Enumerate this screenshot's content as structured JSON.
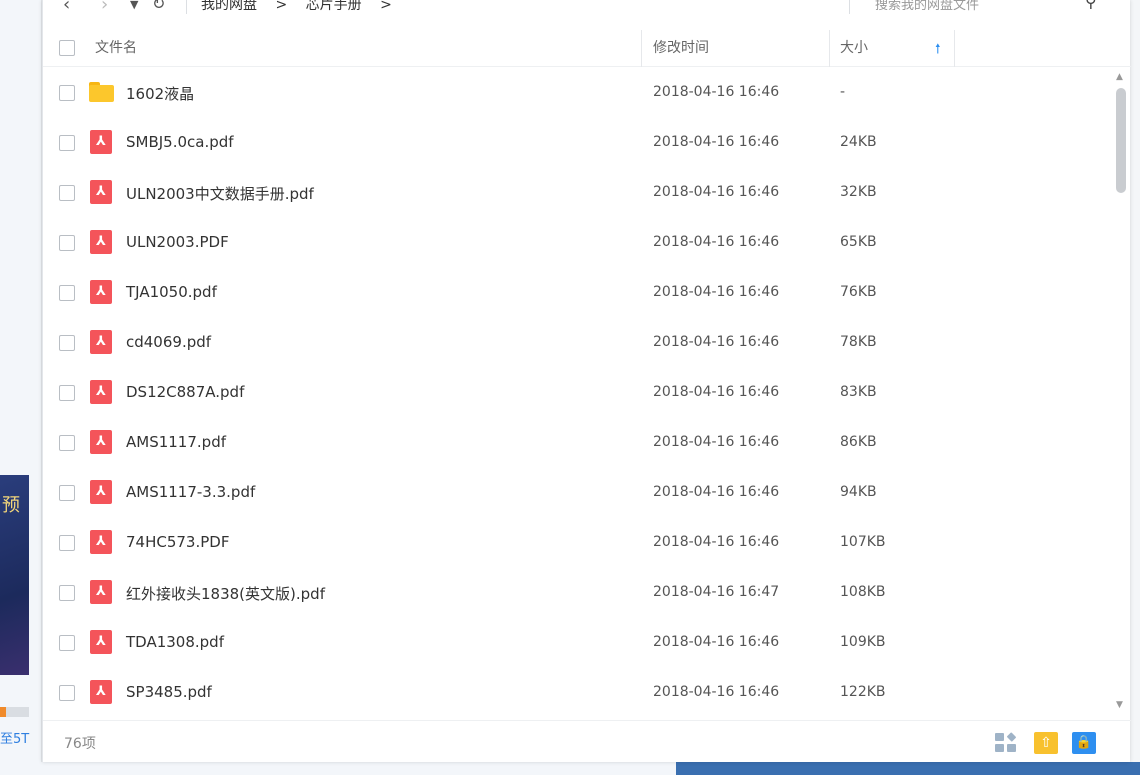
{
  "nav": {
    "back_icon": "chevron-left-icon",
    "forward_icon": "chevron-right-icon",
    "dropdown_icon": "caret-down-icon",
    "refresh_icon": "refresh-icon"
  },
  "breadcrumb": [
    "我的网盘",
    ">",
    "芯片手册",
    ">"
  ],
  "search": {
    "placeholder": "搜索我的网盘文件"
  },
  "columns": {
    "name": "文件名",
    "modified": "修改时间",
    "size": "大小"
  },
  "files": [
    {
      "name": "1602液晶",
      "modified": "2018-04-16 16:46",
      "size": "-",
      "type": "folder"
    },
    {
      "name": "SMBJ5.0ca.pdf",
      "modified": "2018-04-16 16:46",
      "size": "24KB",
      "type": "pdf"
    },
    {
      "name": "ULN2003中文数据手册.pdf",
      "modified": "2018-04-16 16:46",
      "size": "32KB",
      "type": "pdf"
    },
    {
      "name": "ULN2003.PDF",
      "modified": "2018-04-16 16:46",
      "size": "65KB",
      "type": "pdf"
    },
    {
      "name": "TJA1050.pdf",
      "modified": "2018-04-16 16:46",
      "size": "76KB",
      "type": "pdf"
    },
    {
      "name": "cd4069.pdf",
      "modified": "2018-04-16 16:46",
      "size": "78KB",
      "type": "pdf"
    },
    {
      "name": "DS12C887A.pdf",
      "modified": "2018-04-16 16:46",
      "size": "83KB",
      "type": "pdf"
    },
    {
      "name": "AMS1117.pdf",
      "modified": "2018-04-16 16:46",
      "size": "86KB",
      "type": "pdf"
    },
    {
      "name": "AMS1117-3.3.pdf",
      "modified": "2018-04-16 16:46",
      "size": "94KB",
      "type": "pdf"
    },
    {
      "name": "74HC573.PDF",
      "modified": "2018-04-16 16:46",
      "size": "107KB",
      "type": "pdf"
    },
    {
      "name": "红外接收头1838(英文版).pdf",
      "modified": "2018-04-16 16:47",
      "size": "108KB",
      "type": "pdf"
    },
    {
      "name": "TDA1308.pdf",
      "modified": "2018-04-16 16:46",
      "size": "109KB",
      "type": "pdf"
    },
    {
      "name": "SP3485.pdf",
      "modified": "2018-04-16 16:46",
      "size": "122KB",
      "type": "pdf"
    }
  ],
  "footer": {
    "count": "76项"
  },
  "left_panel": {
    "banner_text": "预",
    "link_text": "至5T"
  },
  "colors": {
    "accent": "#2b8ef0",
    "pdf": "#f4545a",
    "folder": "#fcc72c"
  }
}
